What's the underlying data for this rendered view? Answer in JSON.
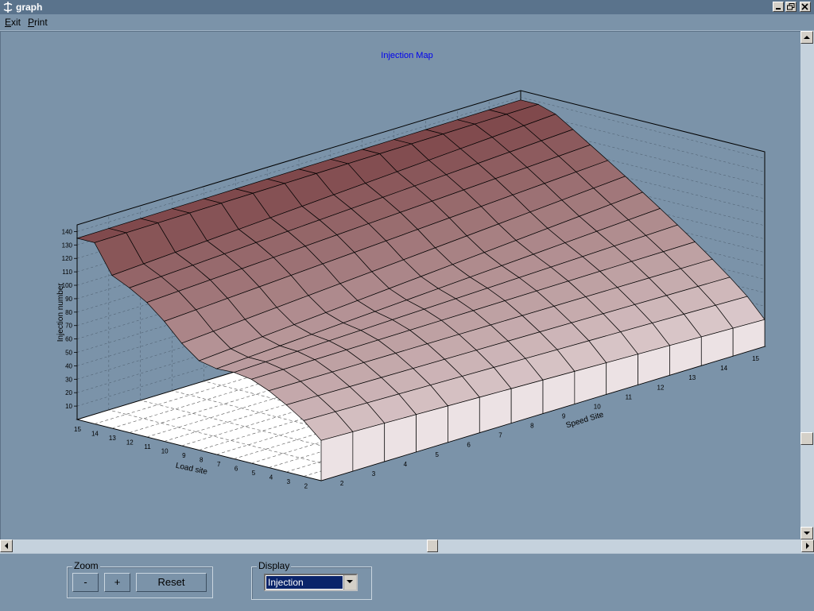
{
  "window": {
    "title": "graph"
  },
  "menu": {
    "exit": "Exit",
    "exit_ul": "E",
    "exit_rest": "xit",
    "print": "Print",
    "print_ul": "P",
    "print_rest": "rint"
  },
  "chart_data": {
    "type": "surface3d",
    "title": "Injection Map",
    "xlabel": "Speed Site",
    "ylabel": "Load site",
    "zlabel": "Injection number",
    "x_ticks": [
      "2",
      "3",
      "4",
      "5",
      "6",
      "7",
      "8",
      "9",
      "10",
      "11",
      "12",
      "13",
      "14",
      "15"
    ],
    "y_ticks": [
      "2",
      "3",
      "4",
      "5",
      "6",
      "7",
      "8",
      "9",
      "10",
      "11",
      "12",
      "13",
      "14",
      "15"
    ],
    "z_ticks": [
      "10",
      "20",
      "30",
      "40",
      "50",
      "60",
      "70",
      "80",
      "90",
      "100",
      "110",
      "120",
      "130",
      "140"
    ],
    "zlim": [
      0,
      145
    ],
    "grid": true,
    "colors": {
      "low": "#f0e6e8",
      "high": "#7c4447",
      "background": "#7b93a9"
    }
  },
  "zoom": {
    "label": "Zoom",
    "minus": "-",
    "plus": "+",
    "reset": "Reset"
  },
  "display": {
    "label": "Display",
    "selected": "Injection"
  },
  "colors": {
    "titlebar": "#5a738c",
    "panel": "#7b93a9",
    "selection": "#0a246a"
  }
}
